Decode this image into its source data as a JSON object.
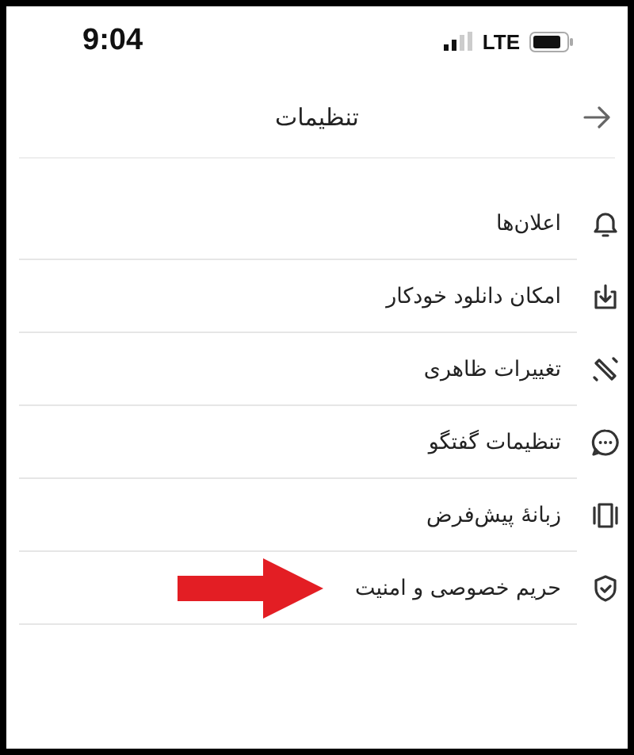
{
  "status_bar": {
    "time": "9:04",
    "network": "LTE"
  },
  "header": {
    "title": "تنظیمات"
  },
  "items": [
    {
      "label": "اعلان‌ها",
      "pointed": false
    },
    {
      "label": "امکان دانلود خودکار",
      "pointed": false
    },
    {
      "label": "تغییرات ظاهری",
      "pointed": false
    },
    {
      "label": "تنظیمات گفتگو",
      "pointed": false
    },
    {
      "label": "زبانهٔ پیش‌فرض",
      "pointed": false
    },
    {
      "label": "حریم خصوصی و امنیت",
      "pointed": true
    }
  ]
}
